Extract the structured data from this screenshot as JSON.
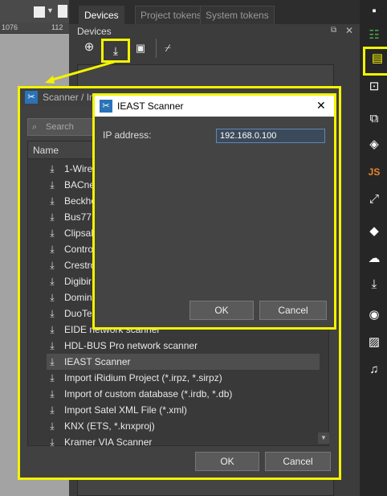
{
  "ruler": {
    "left_value": "1076",
    "right_value": "112"
  },
  "tabs": [
    {
      "label": "Devices"
    },
    {
      "label": "Project tokens"
    },
    {
      "label": "System tokens"
    }
  ],
  "devices_panel": {
    "title": "Devices"
  },
  "toolbar_icons": [
    "plus-circle-icon",
    "import-icon",
    "camera-device-icon",
    "clear-brush-icon"
  ],
  "side_toolbar_icons": [
    "tree-icon",
    "chip-icon",
    "terminal-icon",
    "copy-chip-icon",
    "paint-bucket-icon",
    "js-icon",
    "expand-icon",
    "fill-icon",
    "cloud-icon",
    "download-icon",
    "camera-icon",
    "image-icon",
    "music-icon"
  ],
  "side_js_label": "JS",
  "scanner_dialog": {
    "title": "Scanner / Im",
    "search_placeholder": "Search",
    "column_name": "Name",
    "items": [
      {
        "label": "1-Wire"
      },
      {
        "label": "BACne"
      },
      {
        "label": "Beckho"
      },
      {
        "label": "Bus77"
      },
      {
        "label": "Clipsal"
      },
      {
        "label": "Contro"
      },
      {
        "label": "Crestro"
      },
      {
        "label": "Digibir"
      },
      {
        "label": "Domin"
      },
      {
        "label": "DuoTe"
      },
      {
        "label": "EIDE network scanner"
      },
      {
        "label": "HDL-BUS Pro network scanner"
      },
      {
        "label": "IEAST Scanner"
      },
      {
        "label": "Import iRidium Project (*.irpz, *.sirpz)"
      },
      {
        "label": "Import of custom database (*.irdb, *.db)"
      },
      {
        "label": "Import Satel XML File (*.xml)"
      },
      {
        "label": "KNX (ETS, *.knxproj)"
      },
      {
        "label": "Kramer VIA Scanner"
      }
    ],
    "ok_label": "OK",
    "cancel_label": "Cancel"
  },
  "ieast_dialog": {
    "title": "IEAST Scanner",
    "close_label": "✕",
    "ip_label": "IP address:",
    "ip_value": "192.168.0.100",
    "ok_label": "OK",
    "cancel_label": "Cancel"
  },
  "colors": {
    "highlight": "#f3f300",
    "panel_bg": "#3c3c3c",
    "input_border": "#5f88b5"
  }
}
